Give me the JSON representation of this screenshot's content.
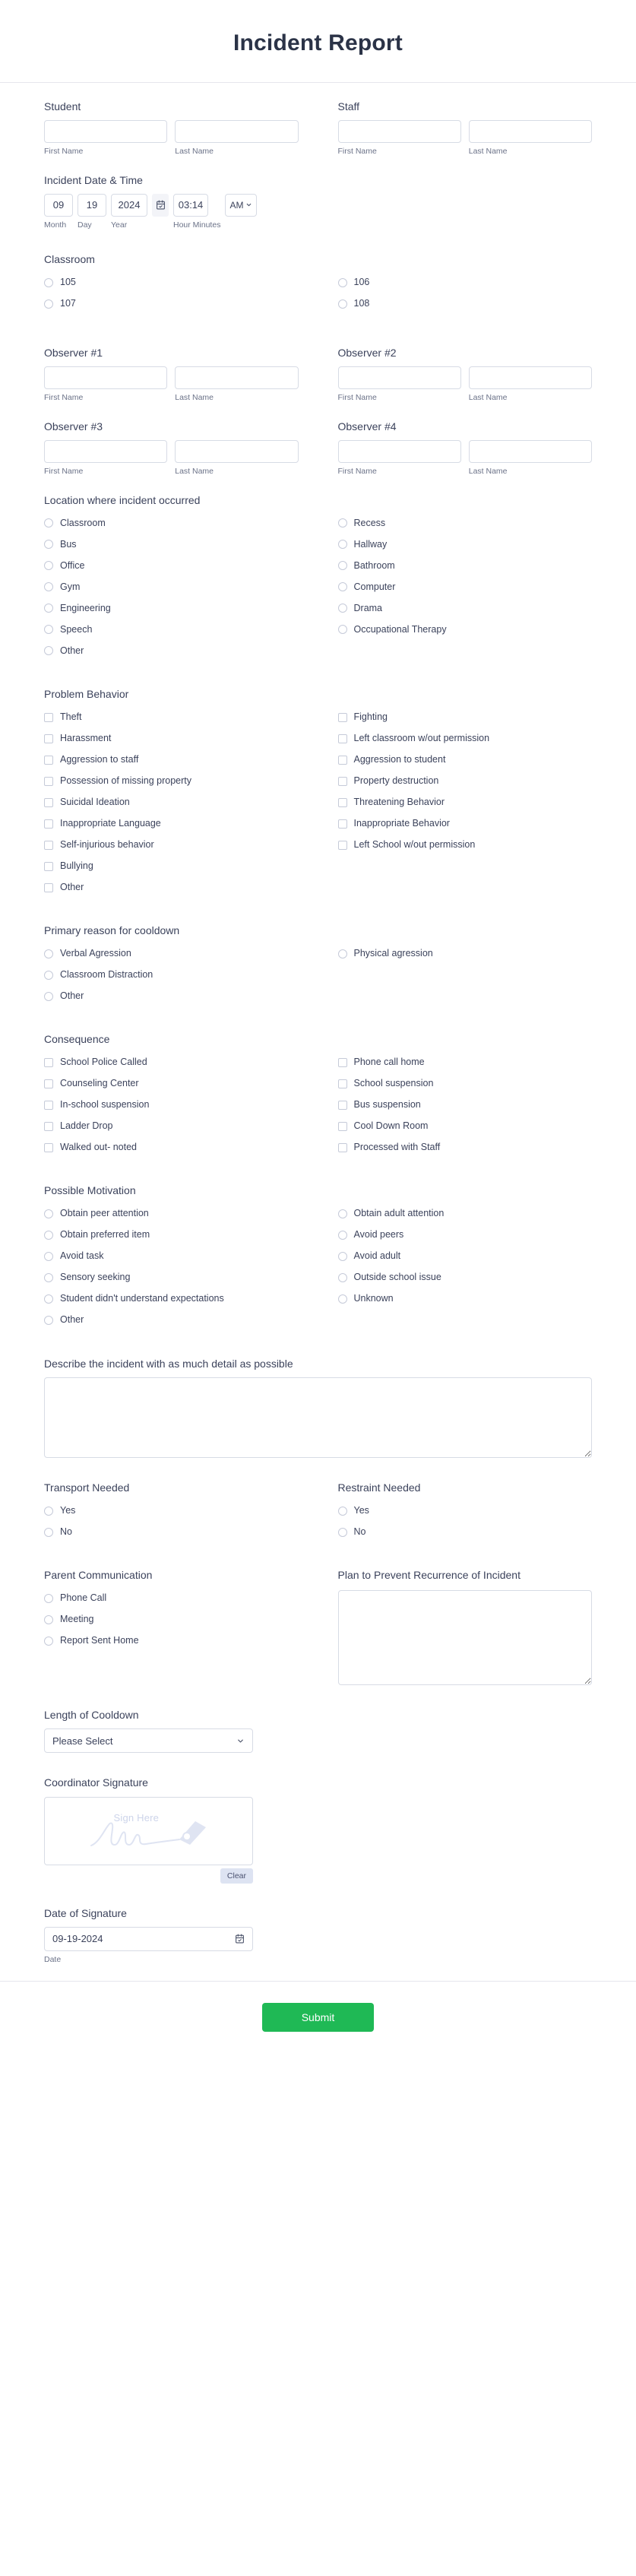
{
  "header": {
    "title": "Incident Report"
  },
  "sections": {
    "student": {
      "label": "Student",
      "first_placeholder": "",
      "last_placeholder": "",
      "first_value": "",
      "last_value": "",
      "first_sub": "First Name",
      "last_sub": "Last Name"
    },
    "staff": {
      "label": "Staff",
      "first_value": "",
      "last_value": "",
      "first_sub": "First Name",
      "last_sub": "Last Name"
    },
    "incident_datetime": {
      "label": "Incident Date & Time",
      "month": "09",
      "day": "19",
      "year": "2024",
      "time": "03:14",
      "ampm": "AM",
      "month_sub": "Month",
      "day_sub": "Day",
      "year_sub": "Year",
      "time_sub": "Hour Minutes"
    },
    "classroom": {
      "label": "Classroom",
      "left": [
        "105",
        "107"
      ],
      "right": [
        "106",
        "108"
      ]
    },
    "observer1": {
      "label": "Observer #1",
      "first_value": "",
      "last_value": "",
      "first_sub": "First Name",
      "last_sub": "Last Name"
    },
    "observer2": {
      "label": "Observer #2",
      "first_value": "",
      "last_value": "",
      "first_sub": "First Name",
      "last_sub": "Last Name"
    },
    "observer3": {
      "label": "Observer #3",
      "first_value": "",
      "last_value": "",
      "first_sub": "First Name",
      "last_sub": "Last Name"
    },
    "observer4": {
      "label": "Observer #4",
      "first_value": "",
      "last_value": "",
      "first_sub": "First Name",
      "last_sub": "Last Name"
    },
    "location": {
      "label": "Location where incident occurred",
      "left": [
        "Classroom",
        "Bus",
        "Office",
        "Gym",
        "Engineering",
        "Speech",
        "Other"
      ],
      "right": [
        "Recess",
        "Hallway",
        "Bathroom",
        "Computer",
        "Drama",
        "Occupational Therapy"
      ]
    },
    "problem_behavior": {
      "label": "Problem Behavior",
      "left": [
        "Theft",
        "Harassment",
        "Aggression to staff",
        "Possession of missing property",
        "Suicidal Ideation",
        "Inappropriate Language",
        "Self-injurious behavior",
        "Bullying",
        "Other"
      ],
      "right": [
        "Fighting",
        "Left classroom w/out permission",
        "Aggression to student",
        "Property destruction",
        "Threatening Behavior",
        "Inappropriate Behavior",
        "Left School w/out permission"
      ]
    },
    "cooldown_reason": {
      "label": "Primary reason for cooldown",
      "left": [
        "Verbal Agression",
        "Classroom Distraction",
        "Other"
      ],
      "right": [
        "Physical agression"
      ]
    },
    "consequence": {
      "label": "Consequence",
      "left": [
        "School Police Called",
        "Counseling Center",
        "In-school suspension",
        "Ladder Drop",
        "Walked out- noted"
      ],
      "right": [
        "Phone call home",
        "School suspension",
        "Bus suspension",
        "Cool Down Room",
        "Processed with Staff"
      ]
    },
    "possible_motivation": {
      "label": "Possible Motivation",
      "left": [
        "Obtain peer attention",
        "Obtain preferred item",
        "Avoid task",
        "Sensory seeking",
        "Student didn't understand expectations",
        "Other"
      ],
      "right": [
        "Obtain adult attention",
        "Avoid peers",
        "Avoid adult",
        "Outside school issue",
        "Unknown"
      ]
    },
    "describe_incident": {
      "label": "Describe the incident with as much detail as possible",
      "value": "",
      "placeholder": ""
    },
    "transport_needed": {
      "label": "Transport Needed",
      "options": [
        "Yes",
        "No"
      ]
    },
    "restraint_needed": {
      "label": "Restraint Needed",
      "options": [
        "Yes",
        "No"
      ]
    },
    "parent_communication": {
      "label": "Parent Communication",
      "options": [
        "Phone Call",
        "Meeting",
        "Report Sent Home"
      ]
    },
    "plan_prevent": {
      "label": "Plan to Prevent Recurrence of Incident",
      "value": "",
      "placeholder": ""
    },
    "length_of_cooldown": {
      "label": "Length of Cooldown",
      "selected": "Please Select"
    },
    "coordinator_signature": {
      "label": "Coordinator Signature",
      "placeholder_text": "Sign Here",
      "clear_label": "Clear"
    },
    "date_of_signature": {
      "label": "Date of Signature",
      "value": "09-19-2024",
      "sub": "Date"
    }
  },
  "footer": {
    "submit_label": "Submit"
  },
  "colors": {
    "accent_submit": "#1fb955",
    "text": "#3b425b",
    "title": "#2b3347",
    "border": "#d7dbe5",
    "sub_text": "#6b7288",
    "signature_hint": "#cdd4ea",
    "clear_bg": "#dde3f2"
  }
}
